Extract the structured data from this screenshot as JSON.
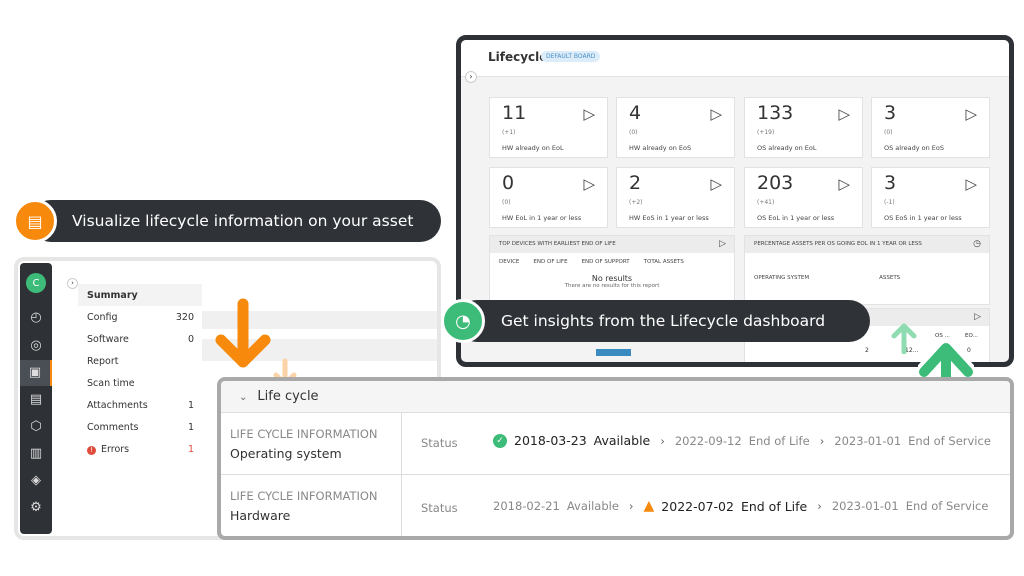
{
  "dashboard": {
    "title": "Lifecycle",
    "badge": "DEFAULT BOARD",
    "cards": [
      {
        "value": "11",
        "delta": "(+1)",
        "label": "HW already on EoL"
      },
      {
        "value": "4",
        "delta": "(0)",
        "label": "HW already on EoS"
      },
      {
        "value": "133",
        "delta": "(+19)",
        "label": "OS already on EoL"
      },
      {
        "value": "3",
        "delta": "(0)",
        "label": "OS already on EoS"
      },
      {
        "value": "0",
        "delta": "(0)",
        "label": "HW EoL in 1 year or less"
      },
      {
        "value": "2",
        "delta": "(+2)",
        "label": "HW EoS in 1 year or less"
      },
      {
        "value": "203",
        "delta": "(+41)",
        "label": "OS EoL in 1 year or less"
      },
      {
        "value": "3",
        "delta": "(-1)",
        "label": "OS EoS in 1 year or less"
      }
    ],
    "top_devices": {
      "title": "TOP DEVICES WITH EARLIEST END OF LIFE",
      "columns": [
        "DEVICE",
        "END OF LIFE",
        "END OF SUPPORT",
        "TOTAL ASSETS"
      ],
      "empty": "No results",
      "empty_sub": "There are no results for this report"
    },
    "percentage": {
      "title": "PERCENTAGE ASSETS PER OS GOING EOL IN 1 YEAR OR LESS",
      "columns": [
        "OPERATING SYSTEM",
        "ASSETS"
      ]
    },
    "bottom_table": {
      "columns": [
        "OS ...",
        "EO..."
      ],
      "row": [
        "2",
        "12...",
        "0"
      ]
    }
  },
  "callouts": {
    "dashboard": "Get insights from the Lifecycle dashboard",
    "asset": "Visualize lifecycle information on your asset"
  },
  "app": {
    "avatar": "C",
    "menu": [
      {
        "label": "Summary",
        "count": ""
      },
      {
        "label": "Config",
        "count": "320"
      },
      {
        "label": "Software",
        "count": "0"
      },
      {
        "label": "Report",
        "count": ""
      },
      {
        "label": "Scan time",
        "count": ""
      },
      {
        "label": "Attachments",
        "count": "1"
      },
      {
        "label": "Comments",
        "count": "1"
      },
      {
        "label": "Errors",
        "count": "1"
      }
    ]
  },
  "lifecycle": {
    "title": "Life cycle",
    "rows": [
      {
        "kicker": "LIFE CYCLE INFORMATION",
        "name": "Operating system",
        "status": "Status",
        "steps": [
          {
            "date": "2018-03-23",
            "label": "Available"
          },
          {
            "date": "2022-09-12",
            "label": "End of Life"
          },
          {
            "date": "2023-01-01",
            "label": "End of Service"
          }
        ]
      },
      {
        "kicker": "LIFE CYCLE INFORMATION",
        "name": "Hardware",
        "status": "Status",
        "steps": [
          {
            "date": "2018-02-21",
            "label": "Available"
          },
          {
            "date": "2022-07-02",
            "label": "End of Life"
          },
          {
            "date": "2023-01-01",
            "label": "End of Service"
          }
        ]
      }
    ]
  },
  "colors": {
    "accent_orange": "#f7890c",
    "accent_green": "#3dbb78",
    "dark": "#2f3338",
    "error": "#e04b3c"
  }
}
